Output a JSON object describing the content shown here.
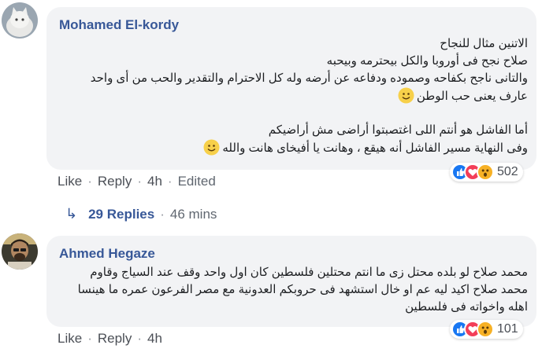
{
  "comments": [
    {
      "author": "Mohamed El-kordy",
      "lines": [
        "الاتنين مثال للنجاح",
        "صلاح نجح فى أوروبا والكل بيحترمه وبيحبه",
        "والتانى ناجح بكفاحه وصموده ودفاعه عن أرضه وله كل الاحترام والتقدير والحب من أى واحد",
        "عارف يعنى حب الوطن",
        "",
        "أما الفاشل هو أنتم اللى اغتصبتوا أراضى مش أراضيكم",
        "وفى النهاية مسير الفاشل أنه هيقع ، وهانت يا أفيخاى هانت والله"
      ],
      "actions": {
        "like": "Like",
        "reply": "Reply",
        "time": "4h",
        "edited": "Edited"
      },
      "reaction_count": "502"
    },
    {
      "author": "Ahmed Hegaze",
      "lines": [
        "محمد صلاح لو بلده محتل زى ما انتم محتلين فلسطين كان اول واحد وقف عند السياج وقاوم",
        "محمد صلاح اكيد ليه عم او خال استشهد فى حروبكم العدونية مع مصر الفرعون عمره ما هينسا",
        "اهله واخواته فى فلسطين"
      ],
      "actions": {
        "like": "Like",
        "reply": "Reply",
        "time": "4h"
      },
      "reaction_count": "101"
    }
  ],
  "replies": {
    "label": "29 Replies",
    "time": "46 mins"
  },
  "icons": [
    "like-reaction-icon",
    "love-reaction-icon",
    "wow-reaction-icon",
    "smile-emoji-icon",
    "reply-arrow-icon"
  ],
  "colors": {
    "link": "#385898",
    "bubble": "#f2f3f5",
    "like": "#1877f2",
    "love": "#f33e58",
    "wow": "#f7b125"
  }
}
